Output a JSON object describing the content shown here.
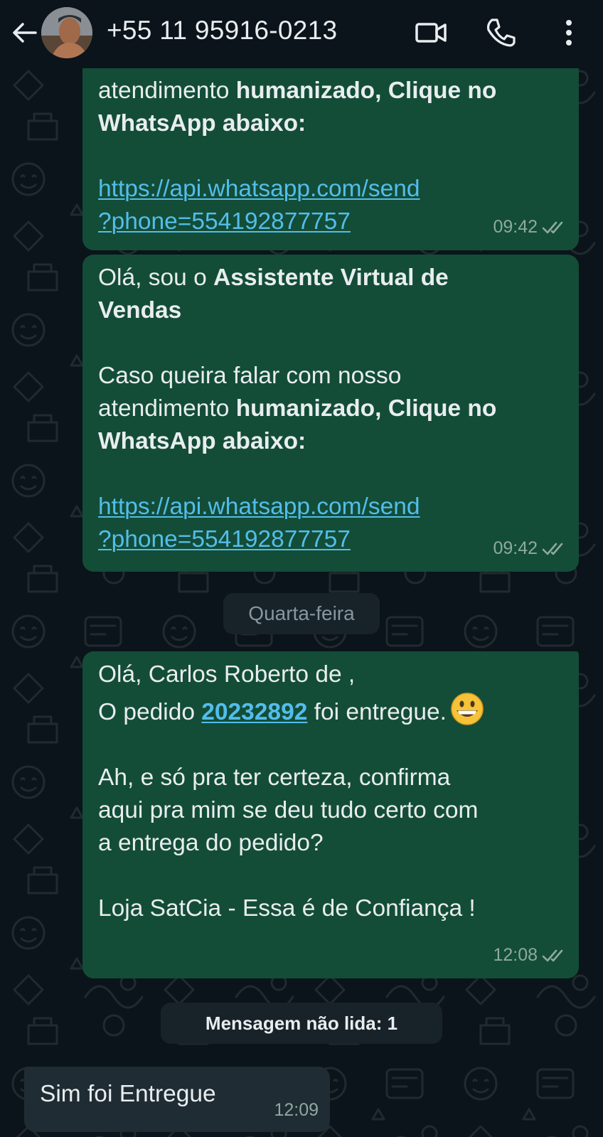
{
  "header": {
    "contact_name": "+55 11 95916-0213"
  },
  "messages": [
    {
      "lines_partial": [
        "atendimento ",
        "humanizado, Clique no",
        "WhatsApp abaixo:"
      ],
      "link_lines": [
        "https://api.whatsapp.com/send",
        "?phone=554192877757"
      ],
      "time": "09:42"
    },
    {
      "greeting_prefix": "Olá, sou o ",
      "greeting_bold": "Assistente Virtual de",
      "greeting_bold_2": "Vendas",
      "body_line_1": "Caso queira falar com nosso",
      "body_line_2_prefix": "atendimento ",
      "body_line_2_bold": "humanizado, Clique no",
      "body_line_3_bold": "WhatsApp abaixo:",
      "link_lines": [
        "https://api.whatsapp.com/send",
        "?phone=554192877757"
      ],
      "time": "09:42"
    },
    {
      "line_1": "Olá, Carlos Roberto de ,",
      "line_2_prefix": "O pedido ",
      "order_number": "20232892",
      "line_2_suffix": " foi entregue.",
      "line_3": "Ah, e só pra ter certeza, confirma",
      "line_4": "aqui pra mim se deu tudo certo com",
      "line_5": "a entrega do pedido?",
      "line_6": "Loja SatCia - Essa é de Confiança !",
      "time": "12:08"
    },
    {
      "text": "Sim foi Entregue",
      "time": "12:09"
    }
  ],
  "date_divider": "Quarta-feira",
  "unread_divider": "Mensagem não lida: 1",
  "colors": {
    "background": "#0b141a",
    "outgoing_bubble": "#134d37",
    "incoming_bubble": "#1f2c34",
    "link": "#53bdeb",
    "text": "#e9edef"
  },
  "icons": {
    "back": "arrow-left-icon",
    "video_call": "video-camera-icon",
    "voice_call": "phone-icon",
    "menu": "more-vertical-icon",
    "read_receipt": "double-check-icon",
    "emoji": "grinning-face-emoji"
  }
}
